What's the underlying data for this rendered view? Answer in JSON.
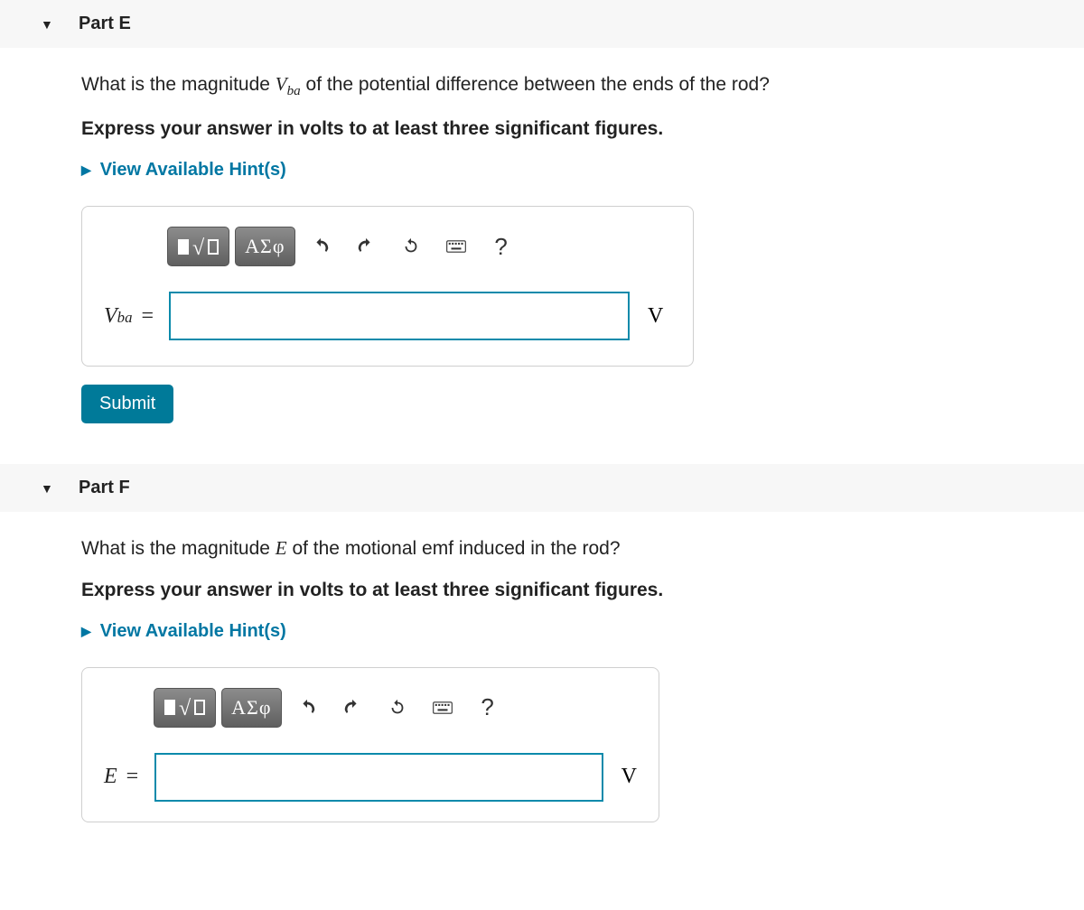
{
  "partE": {
    "title": "Part E",
    "question_pre": "What is the magnitude ",
    "question_var": "V",
    "question_sub": "ba",
    "question_post": " of the potential difference between the ends of the rod?",
    "instruction": "Express your answer in volts to at least three significant figures.",
    "hints_label": "View Available Hint(s)",
    "label_var": "V",
    "label_sub": "ba",
    "unit": "V",
    "submit": "Submit",
    "toolbar": {
      "greek": "ΑΣφ",
      "help": "?"
    }
  },
  "partF": {
    "title": "Part F",
    "question_pre": "What is the magnitude ",
    "question_var": "E",
    "question_post": " of the motional emf induced in the rod?",
    "instruction": "Express your answer in volts to at least three significant figures.",
    "hints_label": "View Available Hint(s)",
    "label_var": "E",
    "unit": "V",
    "toolbar": {
      "greek": "ΑΣφ",
      "help": "?"
    }
  }
}
